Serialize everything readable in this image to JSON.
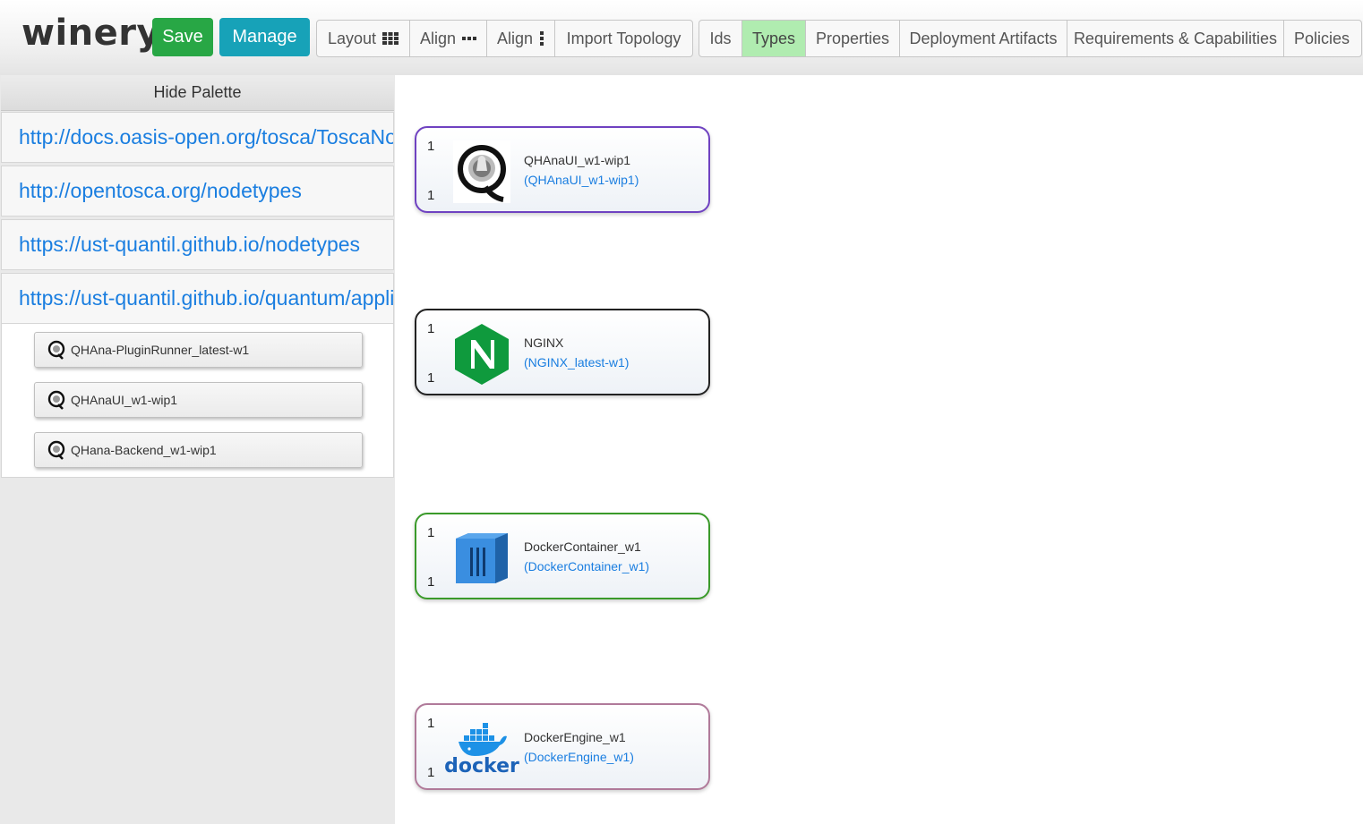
{
  "header": {
    "logo": "winery",
    "save_label": "Save",
    "manage_label": "Manage",
    "layout_group": [
      {
        "label": "Layout",
        "icon": "grid-icon"
      },
      {
        "label": "Align",
        "icon": "horizontal-dots-icon"
      },
      {
        "label": "Align",
        "icon": "vertical-dots-icon"
      },
      {
        "label": "Import Topology",
        "icon": ""
      }
    ],
    "view_group": [
      {
        "label": "Ids",
        "active": false
      },
      {
        "label": "Types",
        "active": true
      },
      {
        "label": "Properties",
        "active": false
      },
      {
        "label": "Deployment Artifacts",
        "active": false
      },
      {
        "label": "Requirements & Capabilities",
        "active": false
      },
      {
        "label": "Policies",
        "active": false
      }
    ]
  },
  "palette": {
    "hide_label": "Hide Palette",
    "namespaces": [
      "http://docs.oasis-open.org/tosca/ToscaNormativeTypes",
      "http://opentosca.org/nodetypes",
      "https://ust-quantil.github.io/nodetypes",
      "https://ust-quantil.github.io/quantum/applications"
    ],
    "items": [
      {
        "label": "QHAna-PluginRunner_latest-w1",
        "icon": "qhana-logo-icon"
      },
      {
        "label": "QHAnaUI_w1-wip1",
        "icon": "qhana-logo-icon"
      },
      {
        "label": "QHana-Backend_w1-wip1",
        "icon": "qhana-logo-icon"
      }
    ]
  },
  "canvas": {
    "nodes": [
      {
        "name": "QHAnaUI_w1-wip1",
        "type": "(QHAnaUI_w1-wip1)",
        "min": "1",
        "max": "1",
        "icon": "qhana-logo-icon",
        "border_color": "#6f42c1"
      },
      {
        "name": "NGINX",
        "type": "(NGINX_latest-w1)",
        "min": "1",
        "max": "1",
        "icon": "nginx-logo-icon",
        "border_color": "#222222"
      },
      {
        "name": "DockerContainer_w1",
        "type": "(DockerContainer_w1)",
        "min": "1",
        "max": "1",
        "icon": "container-icon",
        "border_color": "#3a9a2a"
      },
      {
        "name": "DockerEngine_w1",
        "type": "(DockerEngine_w1)",
        "min": "1",
        "max": "1",
        "icon": "docker-logo-icon",
        "border_color": "#b07a9a",
        "logo_text": "docker"
      }
    ]
  },
  "colors": {
    "save": "#28a745",
    "manage": "#17a2b8",
    "active_tab": "#b0ecb0",
    "link": "#1a7ee0"
  }
}
